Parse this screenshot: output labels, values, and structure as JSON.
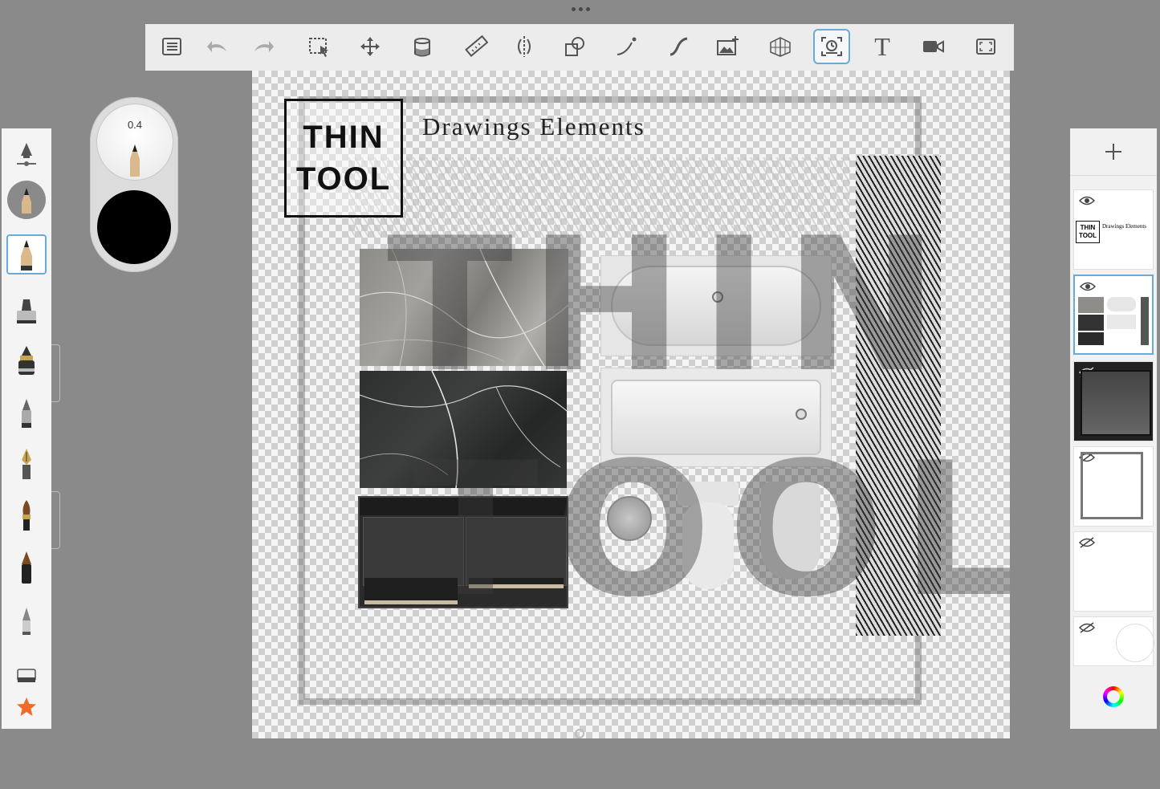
{
  "toolbar": {
    "tools": [
      {
        "name": "menu",
        "icon": "list-icon"
      },
      {
        "name": "undo",
        "icon": "undo-icon"
      },
      {
        "name": "redo",
        "icon": "redo-icon"
      },
      {
        "name": "selection",
        "icon": "selection-icon"
      },
      {
        "name": "transform",
        "icon": "move-icon"
      },
      {
        "name": "fill",
        "icon": "paint-bucket-icon"
      },
      {
        "name": "ruler",
        "icon": "ruler-icon"
      },
      {
        "name": "symmetry",
        "icon": "symmetry-icon"
      },
      {
        "name": "shapes",
        "icon": "shapes-icon"
      },
      {
        "name": "stroke",
        "icon": "stroke-icon"
      },
      {
        "name": "curve",
        "icon": "curve-icon"
      },
      {
        "name": "import-image",
        "icon": "add-image-icon"
      },
      {
        "name": "perspective",
        "icon": "perspective-grid-icon"
      },
      {
        "name": "timelapse",
        "icon": "timelapse-icon",
        "active": true
      },
      {
        "name": "text",
        "icon": "text-icon",
        "glyph": "T"
      },
      {
        "name": "record",
        "icon": "video-icon"
      },
      {
        "name": "fullscreen",
        "icon": "fullscreen-icon"
      }
    ]
  },
  "canvas": {
    "logo_line1": "THIN",
    "logo_line2": "TOOL",
    "title": "Drawings Elements",
    "watermark_line1": "THIN",
    "watermark_line2": "TOOL"
  },
  "brush_panel": {
    "brushes": [
      "brush-settings-icon",
      "pencil-puck-icon",
      "pencil-icon",
      "marker-icon",
      "ink-pen-icon",
      "airbrush-icon",
      "fountain-pen-icon",
      "paintbrush-icon",
      "chisel-pen-icon",
      "soft-pencil-icon",
      "eraser-icon",
      "favorite-star-icon"
    ],
    "selected_index": 2
  },
  "puck": {
    "size_value": "0.4",
    "color": "#000000"
  },
  "layers": {
    "thumb_title_line1": "THIN",
    "thumb_title_line2": "TOOL",
    "thumb_caption": "Drawings Elements",
    "items": [
      {
        "name": "logo-layer",
        "visible": true
      },
      {
        "name": "elements-layer",
        "visible": true,
        "selected": true
      },
      {
        "name": "photo-layer",
        "visible": false
      },
      {
        "name": "plan-layer",
        "visible": false
      },
      {
        "name": "blank-layer",
        "visible": false
      },
      {
        "name": "circle-layer",
        "visible": false
      }
    ]
  },
  "colors": {
    "accent": "#6aaad9",
    "background": "#8a8a8a",
    "panel": "#ececec"
  }
}
